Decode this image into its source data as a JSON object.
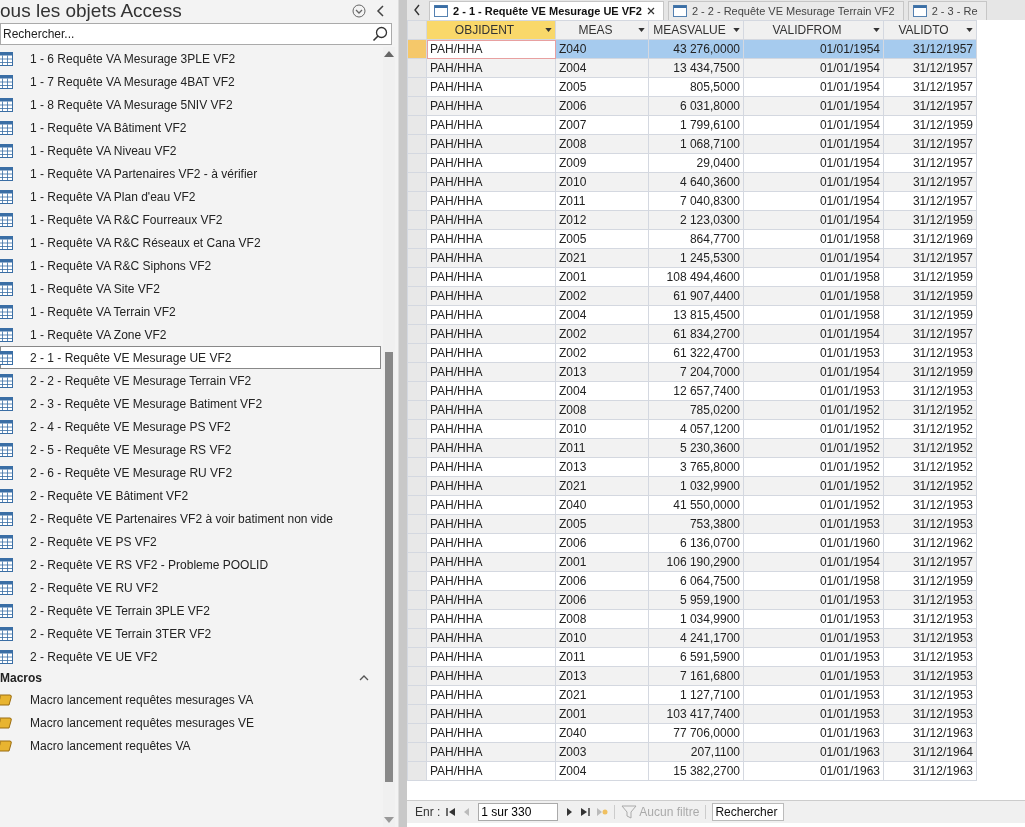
{
  "navigation_pane": {
    "title": "ous les objets Access",
    "search": {
      "placeholder": "Rechercher..."
    },
    "items": [
      {
        "label": "1 - 6 Requête VA Mesurage 3PLE VF2",
        "kind": "query",
        "selected": false
      },
      {
        "label": "1 - 7 Requête VA Mesurage 4BAT VF2",
        "kind": "query",
        "selected": false
      },
      {
        "label": "1 - 8 Requête VA Mesurage 5NIV VF2",
        "kind": "query",
        "selected": false
      },
      {
        "label": "1 - Requête VA Bâtiment VF2",
        "kind": "query",
        "selected": false
      },
      {
        "label": "1 - Requête VA Niveau VF2",
        "kind": "query",
        "selected": false
      },
      {
        "label": "1 - Requête VA Partenaires VF2 - à vérifier",
        "kind": "query",
        "selected": false
      },
      {
        "label": "1 - Requête VA Plan d'eau VF2",
        "kind": "query",
        "selected": false
      },
      {
        "label": "1 - Requête VA R&C Fourreaux VF2",
        "kind": "query",
        "selected": false
      },
      {
        "label": "1 - Requête VA R&C Réseaux et Cana VF2",
        "kind": "query",
        "selected": false
      },
      {
        "label": "1 - Requête VA R&C Siphons VF2",
        "kind": "query",
        "selected": false
      },
      {
        "label": "1 - Requête VA Site VF2",
        "kind": "query",
        "selected": false
      },
      {
        "label": "1 - Requête VA Terrain VF2",
        "kind": "query",
        "selected": false
      },
      {
        "label": "1 - Requête VA Zone VF2",
        "kind": "query",
        "selected": false
      },
      {
        "label": "2 - 1 - Requête VE Mesurage UE VF2",
        "kind": "query",
        "selected": true
      },
      {
        "label": "2 - 2 - Requête VE Mesurage Terrain VF2",
        "kind": "query",
        "selected": false
      },
      {
        "label": "2 - 3 - Requête VE Mesurage Batiment VF2",
        "kind": "query",
        "selected": false
      },
      {
        "label": "2 - 4 - Requête VE Mesurage PS VF2",
        "kind": "query",
        "selected": false
      },
      {
        "label": "2 - 5 - Requête VE Mesurage RS VF2",
        "kind": "query",
        "selected": false
      },
      {
        "label": "2 - 6 - Requête VE Mesurage RU VF2",
        "kind": "query",
        "selected": false
      },
      {
        "label": "2 - Requête VE Bâtiment VF2",
        "kind": "query",
        "selected": false
      },
      {
        "label": "2 - Requête VE Partenaires VF2 à voir batiment non vide",
        "kind": "query",
        "selected": false
      },
      {
        "label": "2 - Requête VE PS VF2",
        "kind": "query",
        "selected": false
      },
      {
        "label": "2 - Requête VE RS VF2 - Probleme POOLID",
        "kind": "query",
        "selected": false
      },
      {
        "label": "2 - Requête VE RU VF2",
        "kind": "query",
        "selected": false
      },
      {
        "label": "2 - Requête VE Terrain 3PLE VF2",
        "kind": "query",
        "selected": false
      },
      {
        "label": "2 - Requête VE Terrain 3TER VF2",
        "kind": "query",
        "selected": false
      },
      {
        "label": "2 - Requête VE UE VF2",
        "kind": "query",
        "selected": false
      }
    ],
    "groups": [
      {
        "title": "Macros",
        "expanded": true,
        "items": [
          {
            "label": "Macro lancement requêtes mesurages VA",
            "kind": "macro",
            "selected": false
          },
          {
            "label": "Macro lancement requêtes mesurages VE",
            "kind": "macro",
            "selected": false
          },
          {
            "label": "Macro lancement requêtes VA",
            "kind": "macro",
            "selected": false
          }
        ]
      }
    ]
  },
  "tabs": [
    {
      "label": "2 - 1 - Requête VE Mesurage UE VF2",
      "selected": true
    },
    {
      "label": "2 - 2 - Requête VE Mesurage Terrain VF2",
      "selected": false
    },
    {
      "label": "2 - 3 - Re",
      "selected": false
    }
  ],
  "table": {
    "columns": [
      "OBJIDENT",
      "MEAS",
      "MEASVALUE",
      "VALIDFROM",
      "VALIDTO"
    ],
    "rows": [
      {
        "selected": true,
        "cells": [
          "PAH/HHA",
          "Z040",
          "43 276,0000",
          "01/01/1954",
          "31/12/1957"
        ]
      },
      {
        "selected": false,
        "cells": [
          "PAH/HHA",
          "Z004",
          "13 434,7500",
          "01/01/1954",
          "31/12/1957"
        ]
      },
      {
        "selected": false,
        "cells": [
          "PAH/HHA",
          "Z005",
          "805,5000",
          "01/01/1954",
          "31/12/1957"
        ]
      },
      {
        "selected": false,
        "cells": [
          "PAH/HHA",
          "Z006",
          "6 031,8000",
          "01/01/1954",
          "31/12/1957"
        ]
      },
      {
        "selected": false,
        "cells": [
          "PAH/HHA",
          "Z007",
          "1 799,6100",
          "01/01/1954",
          "31/12/1959"
        ]
      },
      {
        "selected": false,
        "cells": [
          "PAH/HHA",
          "Z008",
          "1 068,7100",
          "01/01/1954",
          "31/12/1957"
        ]
      },
      {
        "selected": false,
        "cells": [
          "PAH/HHA",
          "Z009",
          "29,0400",
          "01/01/1954",
          "31/12/1957"
        ]
      },
      {
        "selected": false,
        "cells": [
          "PAH/HHA",
          "Z010",
          "4 640,3600",
          "01/01/1954",
          "31/12/1957"
        ]
      },
      {
        "selected": false,
        "cells": [
          "PAH/HHA",
          "Z011",
          "7 040,8300",
          "01/01/1954",
          "31/12/1957"
        ]
      },
      {
        "selected": false,
        "cells": [
          "PAH/HHA",
          "Z012",
          "2 123,0300",
          "01/01/1954",
          "31/12/1959"
        ]
      },
      {
        "selected": false,
        "cells": [
          "PAH/HHA",
          "Z005",
          "864,7700",
          "01/01/1958",
          "31/12/1969"
        ]
      },
      {
        "selected": false,
        "cells": [
          "PAH/HHA",
          "Z021",
          "1 245,5300",
          "01/01/1954",
          "31/12/1957"
        ]
      },
      {
        "selected": false,
        "cells": [
          "PAH/HHA",
          "Z001",
          "108 494,4600",
          "01/01/1958",
          "31/12/1959"
        ]
      },
      {
        "selected": false,
        "cells": [
          "PAH/HHA",
          "Z002",
          "61 907,4400",
          "01/01/1958",
          "31/12/1959"
        ]
      },
      {
        "selected": false,
        "cells": [
          "PAH/HHA",
          "Z004",
          "13 815,4500",
          "01/01/1958",
          "31/12/1959"
        ]
      },
      {
        "selected": false,
        "cells": [
          "PAH/HHA",
          "Z002",
          "61 834,2700",
          "01/01/1954",
          "31/12/1957"
        ]
      },
      {
        "selected": false,
        "cells": [
          "PAH/HHA",
          "Z002",
          "61 322,4700",
          "01/01/1953",
          "31/12/1953"
        ]
      },
      {
        "selected": false,
        "cells": [
          "PAH/HHA",
          "Z013",
          "7 204,7000",
          "01/01/1954",
          "31/12/1959"
        ]
      },
      {
        "selected": false,
        "cells": [
          "PAH/HHA",
          "Z004",
          "12 657,7400",
          "01/01/1953",
          "31/12/1953"
        ]
      },
      {
        "selected": false,
        "cells": [
          "PAH/HHA",
          "Z008",
          "785,0200",
          "01/01/1952",
          "31/12/1952"
        ]
      },
      {
        "selected": false,
        "cells": [
          "PAH/HHA",
          "Z010",
          "4 057,1200",
          "01/01/1952",
          "31/12/1952"
        ]
      },
      {
        "selected": false,
        "cells": [
          "PAH/HHA",
          "Z011",
          "5 230,3600",
          "01/01/1952",
          "31/12/1952"
        ]
      },
      {
        "selected": false,
        "cells": [
          "PAH/HHA",
          "Z013",
          "3 765,8000",
          "01/01/1952",
          "31/12/1952"
        ]
      },
      {
        "selected": false,
        "cells": [
          "PAH/HHA",
          "Z021",
          "1 032,9900",
          "01/01/1952",
          "31/12/1952"
        ]
      },
      {
        "selected": false,
        "cells": [
          "PAH/HHA",
          "Z040",
          "41 550,0000",
          "01/01/1952",
          "31/12/1953"
        ]
      },
      {
        "selected": false,
        "cells": [
          "PAH/HHA",
          "Z005",
          "753,3800",
          "01/01/1953",
          "31/12/1953"
        ]
      },
      {
        "selected": false,
        "cells": [
          "PAH/HHA",
          "Z006",
          "6 136,0700",
          "01/01/1960",
          "31/12/1962"
        ]
      },
      {
        "selected": false,
        "cells": [
          "PAH/HHA",
          "Z001",
          "106 190,2900",
          "01/01/1954",
          "31/12/1957"
        ]
      },
      {
        "selected": false,
        "cells": [
          "PAH/HHA",
          "Z006",
          "6 064,7500",
          "01/01/1958",
          "31/12/1959"
        ]
      },
      {
        "selected": false,
        "cells": [
          "PAH/HHA",
          "Z006",
          "5 959,1900",
          "01/01/1953",
          "31/12/1953"
        ]
      },
      {
        "selected": false,
        "cells": [
          "PAH/HHA",
          "Z008",
          "1 034,9900",
          "01/01/1953",
          "31/12/1953"
        ]
      },
      {
        "selected": false,
        "cells": [
          "PAH/HHA",
          "Z010",
          "4 241,1700",
          "01/01/1953",
          "31/12/1953"
        ]
      },
      {
        "selected": false,
        "cells": [
          "PAH/HHA",
          "Z011",
          "6 591,5900",
          "01/01/1953",
          "31/12/1953"
        ]
      },
      {
        "selected": false,
        "cells": [
          "PAH/HHA",
          "Z013",
          "7 161,6800",
          "01/01/1953",
          "31/12/1953"
        ]
      },
      {
        "selected": false,
        "cells": [
          "PAH/HHA",
          "Z021",
          "1 127,7100",
          "01/01/1953",
          "31/12/1953"
        ]
      },
      {
        "selected": false,
        "cells": [
          "PAH/HHA",
          "Z001",
          "103 417,7400",
          "01/01/1953",
          "31/12/1953"
        ]
      },
      {
        "selected": false,
        "cells": [
          "PAH/HHA",
          "Z040",
          "77 706,0000",
          "01/01/1963",
          "31/12/1963"
        ]
      },
      {
        "selected": false,
        "cells": [
          "PAH/HHA",
          "Z003",
          "207,1100",
          "01/01/1963",
          "31/12/1964"
        ]
      },
      {
        "selected": false,
        "cells": [
          "PAH/HHA",
          "Z004",
          "15 382,2700",
          "01/01/1963",
          "31/12/1963"
        ]
      }
    ]
  },
  "status_bar": {
    "label": "Enr :",
    "record": "1 sur 330",
    "filter": {
      "label": "Aucun filtre",
      "disabled": true
    },
    "search": {
      "placeholder": "Rechercher"
    }
  }
}
